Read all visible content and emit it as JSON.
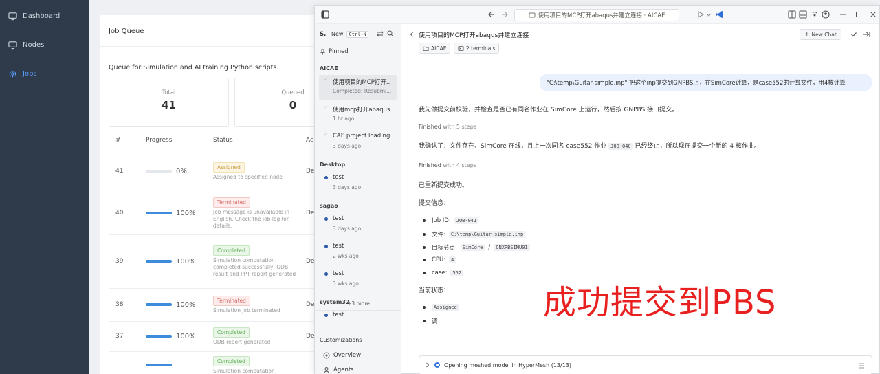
{
  "nav": {
    "items": [
      {
        "label": "Dashboard",
        "icon": "monitor-icon"
      },
      {
        "label": "Nodes",
        "icon": "monitor-icon"
      },
      {
        "label": "Jobs",
        "icon": "gear-icon"
      }
    ]
  },
  "queue": {
    "title": "Job Queue",
    "description": "Queue for Simulation and AI training Python scripts.",
    "stats": [
      {
        "label": "Total",
        "value": "41"
      },
      {
        "label": "Queued",
        "value": "0"
      }
    ],
    "columns": [
      "#",
      "Progress",
      "Status",
      "Ac"
    ],
    "rows": [
      {
        "id": "41",
        "progress": 0,
        "progress_text": "0%",
        "status": "Assigned",
        "status_kind": "assigned",
        "desc": "Assigned to specified node",
        "action": "De"
      },
      {
        "id": "40",
        "progress": 100,
        "progress_text": "100%",
        "status": "Terminated",
        "status_kind": "terminated",
        "desc": "Job message is unavailable in English. Check the job log for details.",
        "action": "De"
      },
      {
        "id": "39",
        "progress": 100,
        "progress_text": "100%",
        "status": "Completed",
        "status_kind": "completed",
        "desc": "Simulation computation completed successfully, ODB result and PPT report generated",
        "action": "De"
      },
      {
        "id": "38",
        "progress": 100,
        "progress_text": "100%",
        "status": "Terminated",
        "status_kind": "terminated",
        "desc": "Simulation job terminated",
        "action": "De"
      },
      {
        "id": "37",
        "progress": 100,
        "progress_text": "100%",
        "status": "Completed",
        "status_kind": "completed",
        "desc": "ODB report generated",
        "action": "De"
      },
      {
        "id": "",
        "progress": 100,
        "progress_text": "",
        "status": "Completed",
        "status_kind": "completed",
        "desc": "Simulation computation",
        "action": ""
      }
    ]
  },
  "window": {
    "url": "使用项目的MCP打开abaqus并建立连接 · AICAE"
  },
  "sidebar": {
    "app_short": "S.",
    "new_label": "New",
    "new_shortcut": "Ctrl+N",
    "pinned": "Pinned",
    "groups": [
      {
        "name": "AICAE",
        "items": [
          {
            "title": "使用项目的MCP打开...",
            "sub": "Completed: Resubmi...",
            "selected": true,
            "kind": "spin"
          },
          {
            "title": "使用mcp打开abaqus...",
            "sub": "1 hr ago",
            "kind": "spin"
          },
          {
            "title": "CAE project loading...",
            "sub": "3 days ago",
            "kind": "spin"
          }
        ]
      },
      {
        "name": "Desktop",
        "items": [
          {
            "title": "test",
            "sub": "3 days ago",
            "kind": "dot"
          }
        ]
      },
      {
        "name": "sagao",
        "items": [
          {
            "title": "test",
            "sub": "3 days ago",
            "kind": "dot"
          },
          {
            "title": "test",
            "sub": "2 wks ago",
            "kind": "dot"
          },
          {
            "title": "test",
            "sub": "3 wks ago",
            "kind": "dot"
          }
        ]
      },
      {
        "name": "system32",
        "items": [
          {
            "title": "test",
            "sub": "",
            "kind": "dot"
          }
        ]
      }
    ],
    "more": "+3 more",
    "customizations": "Customizations",
    "bottom_items": [
      {
        "label": "Overview",
        "icon": "overview-icon"
      },
      {
        "label": "Agents",
        "icon": "agents-icon"
      }
    ]
  },
  "chat": {
    "title": "使用项目的MCP打开abaqus并建立连接",
    "chips": [
      "AICAE",
      "2 terminals"
    ],
    "new_chat": "New Chat",
    "user_message": "\"C:\\temp\\Guitar-simple.inp\" 把这个inp提交到GNPBS上，在SimCore计算，是case552的计算文件，用4核计算",
    "msg1": "我先做提交前校验，并检查是否已有同名作业在 SimCore 上运行，然后按 GNPBS 接口提交。",
    "finished1_a": "Finished",
    "finished1_b": "with 5 steps",
    "msg2_a": "我确认了：文件存在、SimCore 在线，且上一次同名 case552 作业",
    "msg2_code": "JOB-040",
    "msg2_b": "已经终止，所以现在提交一个新的 4 核作业。",
    "finished2_a": "Finished",
    "finished2_b": "with 4 steps",
    "msg3": "已重新提交成功。",
    "msg4": "提交信息：",
    "info": [
      {
        "label": "Job ID:",
        "code": "JOB-041"
      },
      {
        "label": "文件:",
        "code": "C:\\temp\\Guitar-simple.inp"
      },
      {
        "label": "目标节点:",
        "code": "SimCore",
        "sep": "/",
        "code2": "CNXPBSIMU01"
      },
      {
        "label": "CPU:",
        "code": "4"
      },
      {
        "label": "case:",
        "code": "552"
      }
    ],
    "status_title": "当前状态：",
    "status_items": [
      {
        "code": "Assigned"
      },
      {
        "text": "调"
      }
    ],
    "overlay": "成功提交到PBS",
    "bottom_status": "Opening meshed model in HyperMesh (13/13)"
  }
}
